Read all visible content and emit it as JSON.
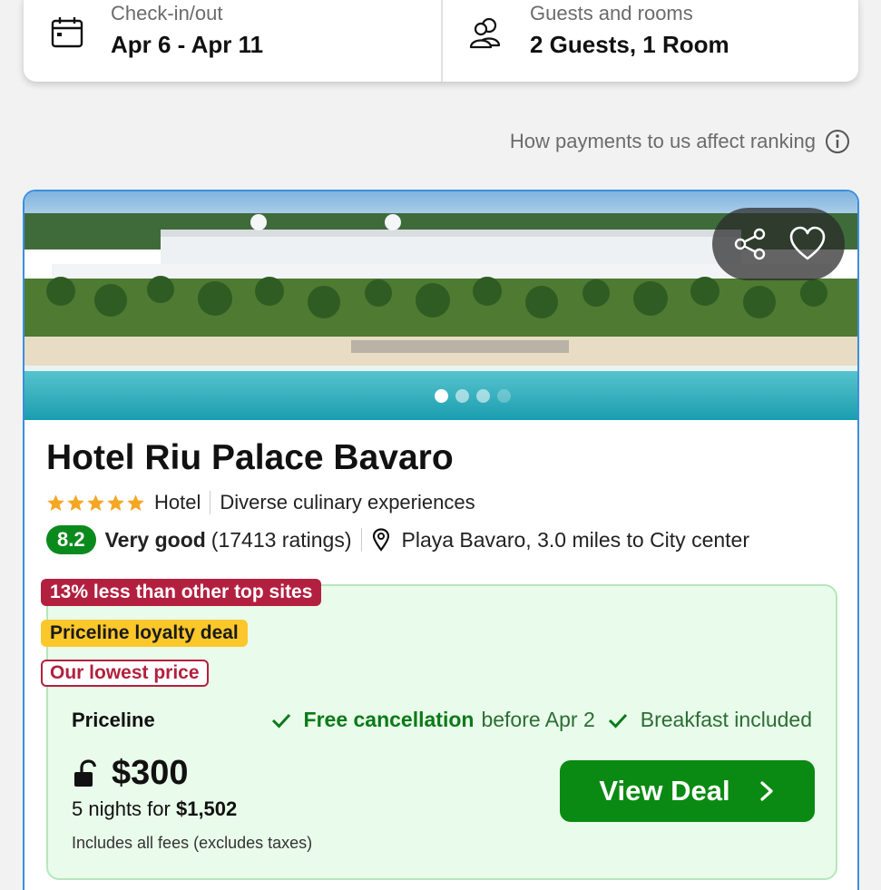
{
  "search": {
    "dates": {
      "label": "Check-in/out",
      "value": "Apr 6 - Apr 11",
      "icon": "calendar-icon"
    },
    "guests": {
      "label": "Guests and rooms",
      "value": "2 Guests, 1 Room",
      "icon": "users-icon"
    }
  },
  "ranking_link": {
    "text": "How payments to us affect ranking",
    "icon": "info-icon"
  },
  "hotel": {
    "name": "Hotel Riu Palace Bavaro",
    "star_rating": 5,
    "type": "Hotel",
    "tagline": "Diverse culinary experiences",
    "score": "8.2",
    "rating_word": "Very good",
    "rating_count": "(17413 ratings)",
    "location": "Playa Bavaro, 3.0 miles to City center",
    "photo": {
      "current": 1,
      "total": 4
    }
  },
  "badges": {
    "less_than": "13% less than other top sites",
    "loyalty": "Priceline loyalty deal",
    "lowest": "Our lowest price"
  },
  "deal": {
    "provider": "Priceline",
    "free_cancel": "Free cancellation",
    "cancel_tail": "before Apr 2",
    "breakfast": "Breakfast included",
    "price": "$300",
    "nights_prefix": "5 nights for",
    "total": "$1,502",
    "fees": "Includes all fees (excludes taxes)",
    "button": "View Deal"
  },
  "colors": {
    "accent_border": "#3a8fe0",
    "score_green": "#0a8a1c",
    "deal_button": "#0a8a12",
    "badge_red": "#b3203f",
    "badge_yellow": "#fcc72b",
    "deal_bg": "#e9fbea",
    "star_orange": "#f5a623"
  }
}
